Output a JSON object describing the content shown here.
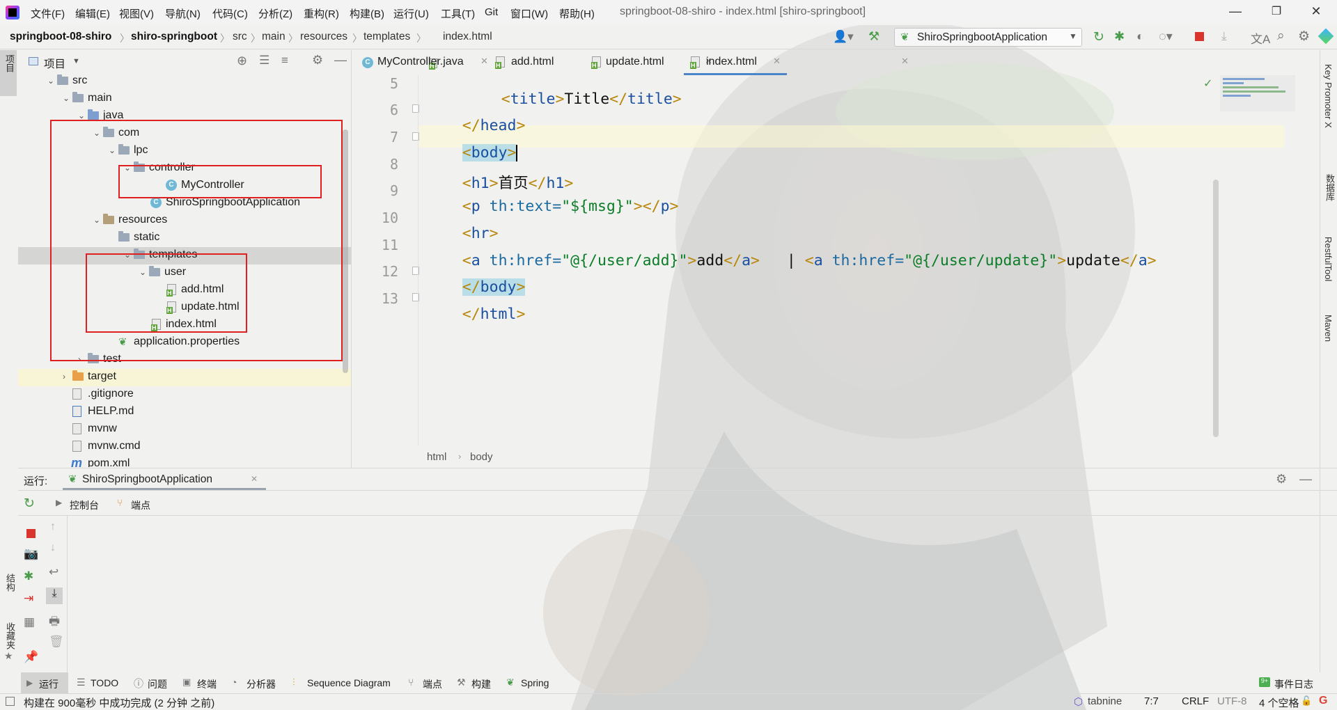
{
  "menu": [
    "文件(F)",
    "编辑(E)",
    "视图(V)",
    "导航(N)",
    "代码(C)",
    "分析(Z)",
    "重构(R)",
    "构建(B)",
    "运行(U)",
    "工具(T)",
    "Git",
    "窗口(W)",
    "帮助(H)"
  ],
  "window_title": "springboot-08-shiro - index.html [shiro-springboot]",
  "breadcrumb": [
    "springboot-08-shiro",
    "shiro-springboot",
    "src",
    "main",
    "resources",
    "templates",
    "index.html"
  ],
  "run_config": "ShiroSpringbootApplication",
  "project_panel": {
    "title": "项目"
  },
  "tree": [
    {
      "label": "src",
      "type": "folder"
    },
    {
      "label": "main",
      "type": "folder"
    },
    {
      "label": "java",
      "type": "folder-src"
    },
    {
      "label": "com",
      "type": "package"
    },
    {
      "label": "lpc",
      "type": "package"
    },
    {
      "label": "controller",
      "type": "package"
    },
    {
      "label": "MyController",
      "type": "class"
    },
    {
      "label": "ShiroSpringbootApplication",
      "type": "class"
    },
    {
      "label": "resources",
      "type": "folder-res"
    },
    {
      "label": "static",
      "type": "folder"
    },
    {
      "label": "templates",
      "type": "folder"
    },
    {
      "label": "user",
      "type": "folder"
    },
    {
      "label": "add.html",
      "type": "html"
    },
    {
      "label": "update.html",
      "type": "html"
    },
    {
      "label": "index.html",
      "type": "html"
    },
    {
      "label": "application.properties",
      "type": "props"
    },
    {
      "label": "test",
      "type": "folder"
    },
    {
      "label": "target",
      "type": "folder-orange"
    },
    {
      "label": ".gitignore",
      "type": "file"
    },
    {
      "label": "HELP.md",
      "type": "md"
    },
    {
      "label": "mvnw",
      "type": "file"
    },
    {
      "label": "mvnw.cmd",
      "type": "file"
    },
    {
      "label": "pom.xml",
      "type": "maven"
    }
  ],
  "tabs": [
    {
      "label": "MyController.java",
      "active": false
    },
    {
      "label": "add.html",
      "active": false
    },
    {
      "label": "update.html",
      "active": false
    },
    {
      "label": "index.html",
      "active": true
    }
  ],
  "line_numbers": [
    "5",
    "6",
    "7",
    "8",
    "9",
    "10",
    "11",
    "12",
    "13"
  ],
  "code": {
    "l5": {
      "open": "<",
      "tag": "title",
      "close": ">",
      "text": "Title",
      "eopen": "</",
      "etag": "title",
      "eclose": ">"
    },
    "l6": {
      "open": "</",
      "tag": "head",
      "close": ">"
    },
    "l7": {
      "open": "<",
      "tag": "body",
      "close": ">"
    },
    "l8": {
      "open": "<",
      "tag": "h1",
      "close": ">",
      "text": "首页",
      "eopen": "</",
      "etag": "h1",
      "eclose": ">"
    },
    "l9": {
      "open": "<",
      "tag": "p",
      "attr": " th:text=",
      "val": "\"${msg}\"",
      "close": ">",
      "eopen": "</",
      "etag": "p",
      "eclose": ">"
    },
    "l10": {
      "open": "<",
      "tag": "hr",
      "close": ">"
    },
    "l11": {
      "open": "<",
      "tag": "a",
      "attr": " th:href=",
      "val": "\"@{/user/add}\"",
      "close": ">",
      "text": "add",
      "eopen": "</",
      "etag": "a",
      "eclose": ">",
      "sep": "   | ",
      "open2": "<",
      "tag2": "a",
      "attr2": " th:href=",
      "val2": "\"@{/user/update}\"",
      "close2": ">",
      "text2": "update",
      "eopen2": "</",
      "etag2": "a",
      "eclose2": ">"
    },
    "l12": {
      "open": "</",
      "tag": "body",
      "close": ">"
    },
    "l13": {
      "open": "</",
      "tag": "html",
      "close": ">"
    }
  },
  "editor_breadcrumb": [
    "html",
    "body"
  ],
  "run_panel": {
    "label": "运行:",
    "config": "ShiroSpringbootApplication",
    "tab_console": "控制台",
    "tab_endpoints": "端点"
  },
  "bottom_tools": [
    "运行",
    "TODO",
    "问题",
    "终端",
    "分析器",
    "Sequence Diagram",
    "端点",
    "构建",
    "Spring"
  ],
  "event_log": "事件日志",
  "status": {
    "message": "构建在 900毫秒 中成功完成 (2 分钟 之前)",
    "tabnine": "tabnine",
    "position": "7:7",
    "line_sep": "CRLF",
    "encoding": "UTF-8",
    "indent": "4 个空格"
  },
  "right_tools": [
    "Key Promoter X",
    "数据库",
    "RestfulTool",
    "Maven"
  ],
  "left_tools": [
    "项目",
    "结构",
    "收藏夹"
  ]
}
